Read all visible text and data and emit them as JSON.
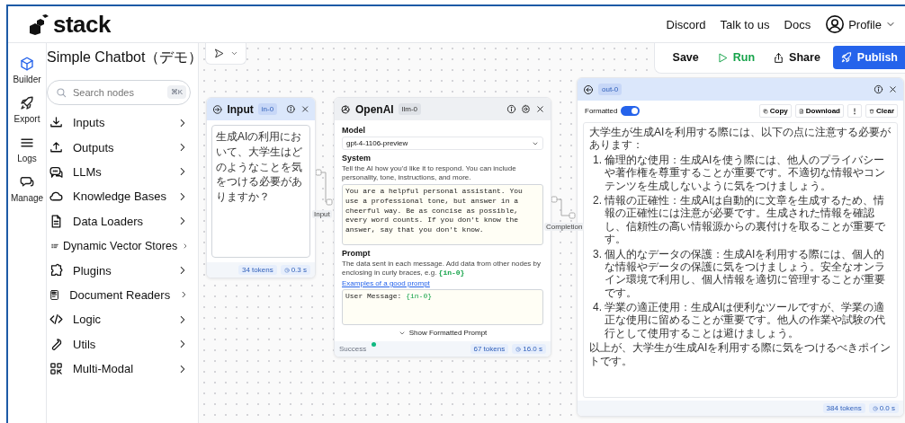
{
  "header": {
    "logo": "stack",
    "links": [
      "Discord",
      "Talk to us",
      "Docs"
    ],
    "profile": "Profile"
  },
  "rail": [
    {
      "label": "Builder",
      "selected": true
    },
    {
      "label": "Export",
      "selected": false
    },
    {
      "label": "Logs",
      "selected": false
    },
    {
      "label": "Manage",
      "selected": false
    }
  ],
  "panel": {
    "title": "Simple Chatbot（デモ）",
    "search": {
      "placeholder": "Search nodes",
      "shortcut": "⌘K"
    },
    "categories": [
      "Inputs",
      "Outputs",
      "LLMs",
      "Knowledge Bases",
      "Data Loaders",
      "Dynamic Vector Stores",
      "Plugins",
      "Document Readers",
      "Logic",
      "Utils",
      "Multi-Modal"
    ]
  },
  "toolbar": {
    "save": "Save",
    "run": "Run",
    "share": "Share",
    "publish": "Publish"
  },
  "nodes": {
    "input": {
      "title": "Input",
      "badge": "in-0",
      "text": "生成AIの利用において、大学生はどのようなことを気をつける必要がありますか？",
      "tokens": "34 tokens",
      "time": "0.3 s"
    },
    "llm": {
      "title": "OpenAI",
      "badge": "llm-0",
      "model_label": "Model",
      "model": "gpt-4-1106-preview",
      "system_label": "System",
      "system_hint": "Tell the AI how you'd like it to respond. You can include personality, tone, instructions, and more.",
      "system": "You are a helpful personal assistant. You use a professional tone, but answer in a cheerful way. Be as concise as possible, every word counts. If you don't know the answer, say that you don't know.",
      "prompt_label": "Prompt",
      "prompt_hint": "The data sent in each message. Add data from other nodes by enclosing in curly braces, e.g. **{in-0}**",
      "prompt_link": "Examples of a good prompt",
      "prompt": "User Message: **{in-0}**",
      "show_prompt": "Show Formatted Prompt",
      "status": "Success",
      "tokens": "67 tokens",
      "time": "16.0 s"
    },
    "output": {
      "badge": "out-0",
      "toggle_label": "Formatted",
      "formatted": true,
      "copy": "Copy",
      "download": "Download",
      "more": "⋮",
      "clear": "Clear",
      "intro": "大学生が生成AIを利用する際には、以下の点に注意する必要があります：",
      "items": [
        {
          "number": "1.",
          "text": "倫理的な使用：生成AIを使う際には、他人のプライバシーや著作権を尊重することが重要です。不適切な情報やコンテンツを生成しないように気をつけましょう。"
        },
        {
          "number": "2.",
          "text": "情報の正確性：生成AIは自動的に文章を生成するため、情報の正確性には注意が必要です。生成された情報を確認し、信頼性の高い情報源からの裏付けを取ることが重要です。"
        },
        {
          "number": "3.",
          "text": "個人的なデータの保護：生成AIを利用する際には、個人的な情報やデータの保護に気をつけましょう。安全なオンライン環境で利用し、個人情報を適切に管理することが重要です。"
        },
        {
          "number": "4.",
          "text": "学業の適正使用：生成AIは便利なツールですが、学業の適正な使用に留めることが重要です。他人の作業や試験の代行として使用することは避けましょう。"
        }
      ],
      "conclusion": "以上が、大学生が生成AIを利用する際に気をつけるべきポイントです。",
      "tokens": "384 tokens",
      "time": "0.0 s"
    }
  },
  "edges": [
    {
      "label": "Input"
    },
    {
      "label": "Completion"
    }
  ]
}
